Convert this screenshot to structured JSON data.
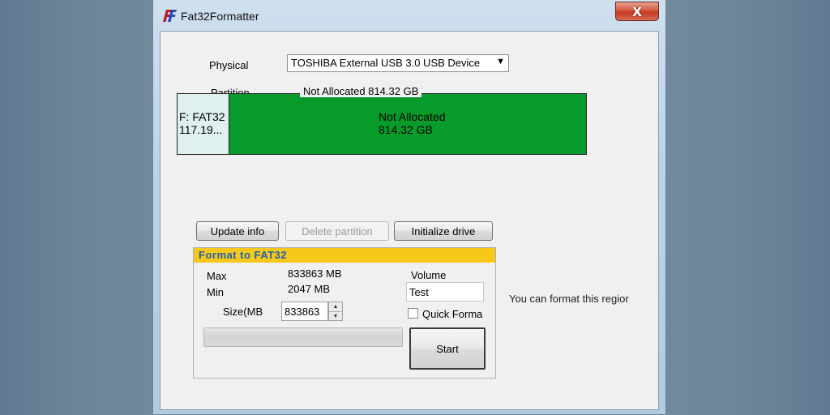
{
  "window": {
    "title": "Fat32Formatter",
    "close_glyph": "X"
  },
  "physical": {
    "label": "Physical",
    "selected": "TOSHIBA External USB 3.0 USB Device"
  },
  "partition": {
    "label": "Partition",
    "caption": "Not Allocated  814.32 GB",
    "segments": [
      {
        "line1": "F: FAT32",
        "line2": "117.19...",
        "color": "#dff0f0"
      },
      {
        "line1": "Not Allocated",
        "line2": "814.32 GB",
        "color": "#079b2c"
      }
    ]
  },
  "buttons": {
    "update_info": "Update info",
    "delete_partition": "Delete partition",
    "initialize_drive": "Initialize drive"
  },
  "format_group": {
    "title": "Format to FAT32",
    "max_label": "Max",
    "max_value": "833863 MB",
    "min_label": "Min",
    "min_value": "2047 MB",
    "size_label": "Size(MB",
    "size_value": "833863",
    "volume_label": "Volume",
    "volume_value": "Test",
    "quick_format_label": "Quick Forma",
    "quick_format_checked": false,
    "progress_percent": 0,
    "start_label": "Start"
  },
  "hint": "You can format this regior",
  "colors": {
    "header_bg": "#f7c81a",
    "header_text": "#1f5fb0",
    "unallocated": "#079b2c"
  },
  "icons": {
    "app": "fat32-logo-icon",
    "spin_up": "chevron-up-icon",
    "spin_down": "chevron-down-icon",
    "dropdown": "dropdown-arrow-icon"
  }
}
